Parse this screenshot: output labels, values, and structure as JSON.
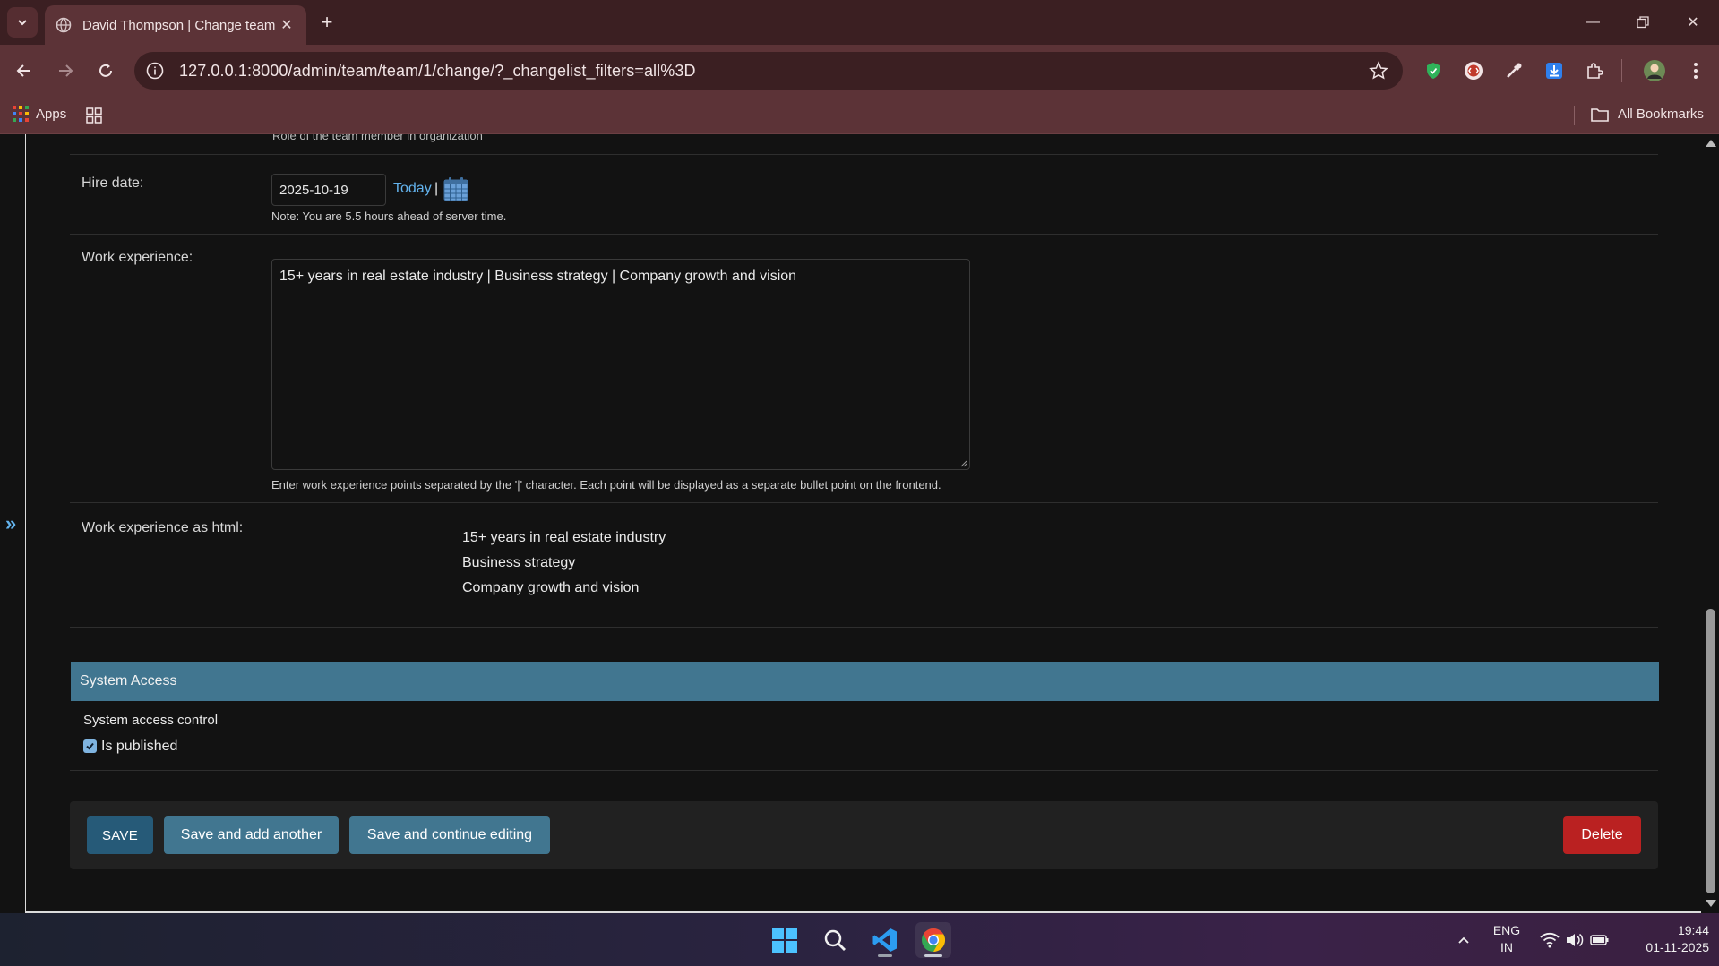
{
  "browser": {
    "tab_title": "David Thompson | Change team",
    "url": "127.0.0.1:8000/admin/team/team/1/change/?_changelist_filters=all%3D",
    "bookmarks_apps": "Apps",
    "bookmarks_all": "All Bookmarks"
  },
  "form": {
    "role_help": "Role of the team member in organization",
    "hire_date": {
      "label": "Hire date:",
      "value": "2025-10-19",
      "today_link": "Today",
      "separator": "|",
      "note": "Note: You are 5.5 hours ahead of server time."
    },
    "work_experience": {
      "label": "Work experience:",
      "value": "15+ years in real estate industry | Business strategy | Company growth and vision",
      "help": "Enter work experience points separated by the '|' character. Each point will be displayed as a separate bullet point on the frontend."
    },
    "work_experience_html": {
      "label": "Work experience as html:",
      "items": [
        "15+ years in real estate industry",
        "Business strategy",
        "Company growth and vision"
      ]
    },
    "system_access": {
      "header": "System Access",
      "description": "System access control",
      "is_published_label": "Is published",
      "is_published": true
    },
    "buttons": {
      "save": "SAVE",
      "save_add": "Save and add another",
      "save_continue": "Save and continue editing",
      "delete": "Delete"
    }
  },
  "taskbar": {
    "lang_top": "ENG",
    "lang_bottom": "IN",
    "time": "19:44",
    "date": "01-11-2025"
  },
  "colors": {
    "module_header": "#417690",
    "save_button": "#265a78",
    "delete_button": "#ba2121",
    "link": "#63b3ed"
  }
}
